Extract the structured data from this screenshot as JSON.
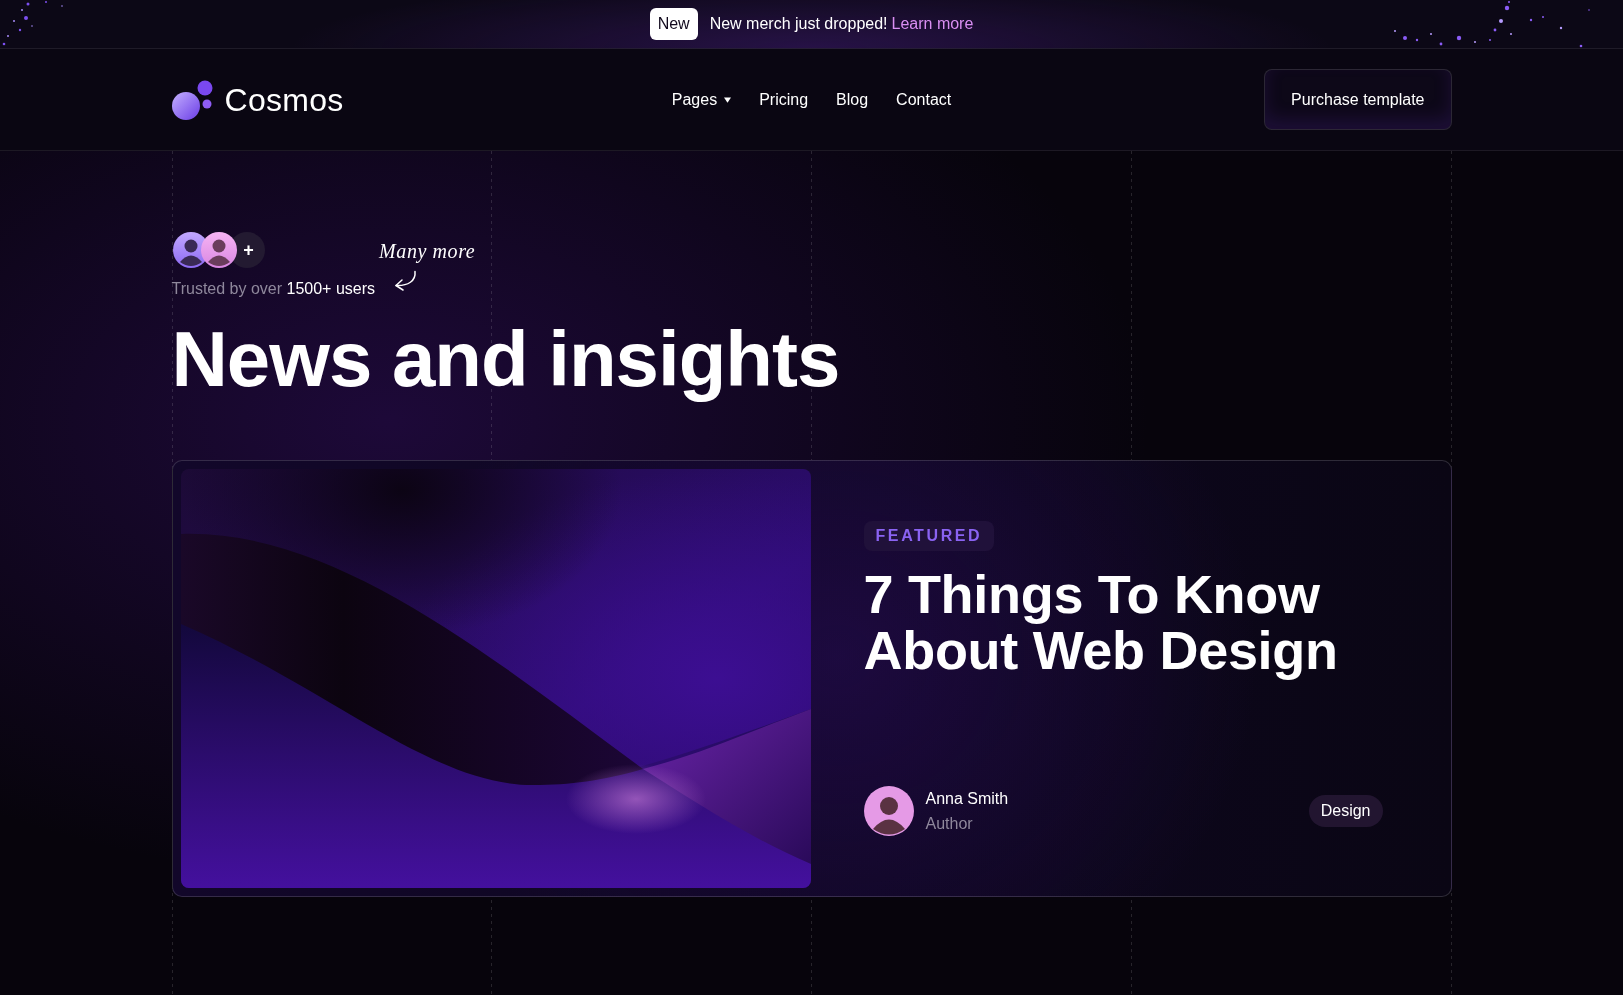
{
  "announcement": {
    "badge": "New",
    "text": "New merch just dropped!",
    "link": "Learn more"
  },
  "header": {
    "brand": "Cosmos",
    "nav": [
      {
        "label": "Pages",
        "dropdown": true
      },
      {
        "label": "Pricing",
        "dropdown": false
      },
      {
        "label": "Blog",
        "dropdown": false
      },
      {
        "label": "Contact",
        "dropdown": false
      }
    ],
    "cta": "Purchase template"
  },
  "hero": {
    "more_users": "+",
    "annotation": "Many more",
    "trusted": "Trusted by over **1500+ users**",
    "title": "News and insights"
  },
  "featured_post": {
    "tag": "FEATURED",
    "title": "7 Things To Know About Web Design",
    "author": {
      "name": "Anna Smith",
      "role": "Author"
    },
    "category": "Design"
  }
}
